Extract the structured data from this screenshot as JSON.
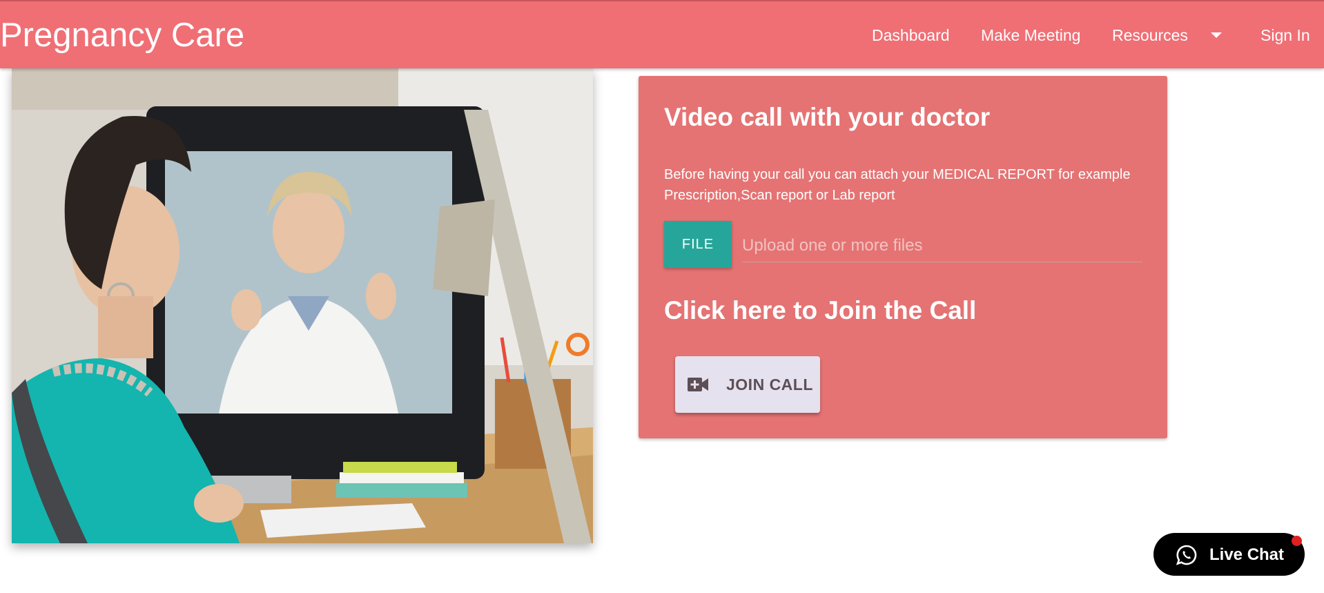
{
  "navbar": {
    "brand": "Pregnancy Care",
    "links": [
      {
        "label": "Dashboard"
      },
      {
        "label": "Make Meeting"
      },
      {
        "label": "Resources"
      },
      {
        "label": "Sign In"
      }
    ]
  },
  "card": {
    "title": "Video call with your doctor",
    "description": "Before having your call you can attach your MEDICAL REPORT for example Prescription,Scan report or Lab report",
    "file_button": "FILE",
    "file_placeholder": "Upload one or more files",
    "join_title": "Click here to Join the Call",
    "join_button": "JOIN CALL"
  },
  "live_chat": {
    "label": "Live Chat"
  },
  "colors": {
    "navbar": "#ef6f75",
    "card": "#e57373",
    "file_button": "#26a69a",
    "join_button": "#e6e1ee",
    "live_chat": "#000000",
    "notification_dot": "#e02020"
  }
}
